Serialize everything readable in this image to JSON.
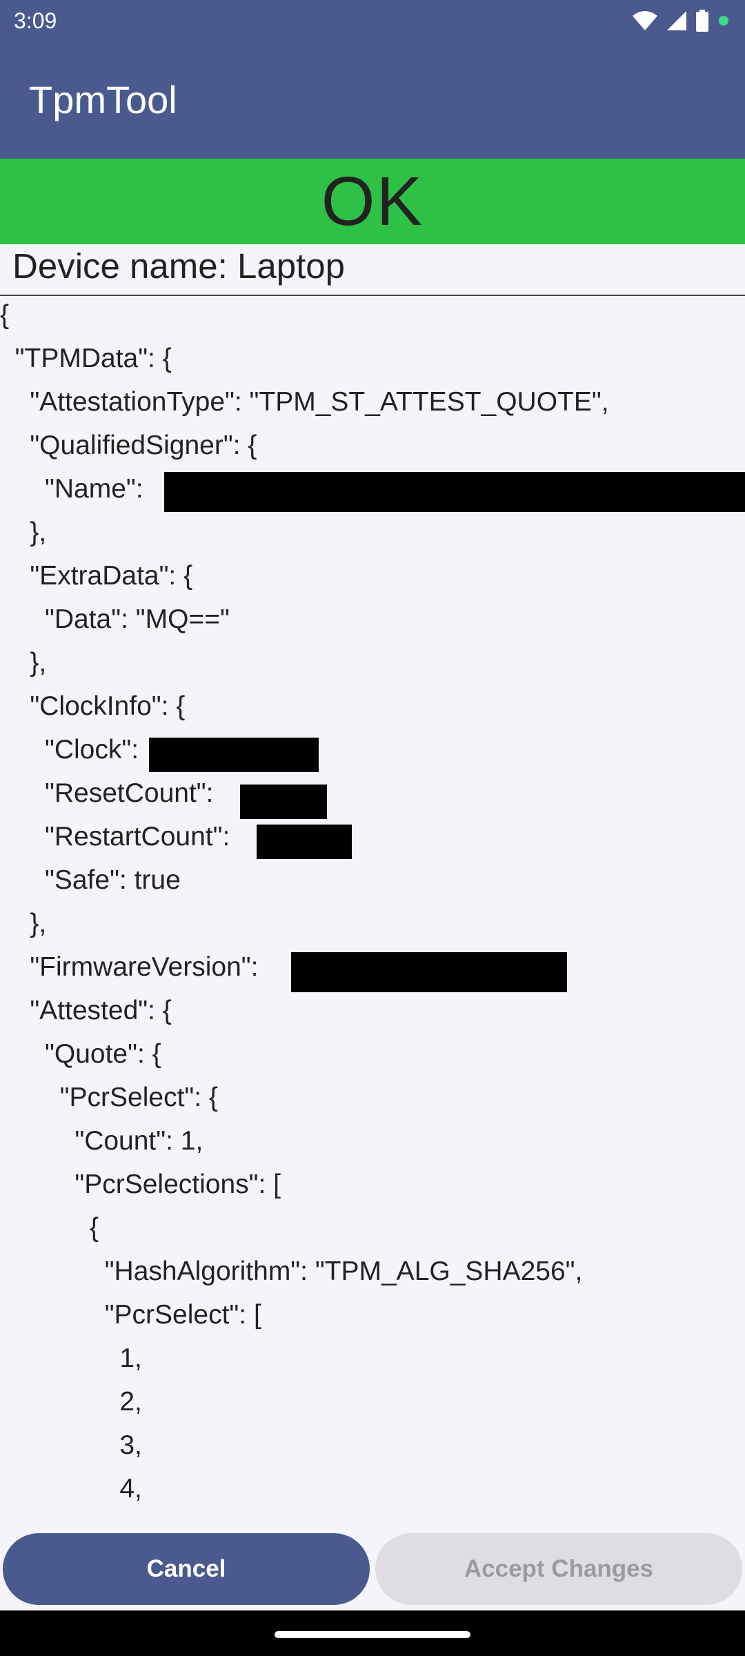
{
  "status_bar": {
    "time": "3:09",
    "icons": [
      "wifi-icon",
      "signal-icon",
      "battery-icon",
      "dot-indicator-icon"
    ]
  },
  "app_bar": {
    "title": "TpmTool"
  },
  "banner": {
    "text": "OK",
    "color": "#2ec145"
  },
  "device": {
    "label": "Device name: Laptop"
  },
  "json_lines": [
    "{",
    "  \"TPMData\": {",
    "    \"AttestationType\": \"TPM_ST_ATTEST_QUOTE\",",
    "    \"QualifiedSigner\": {",
    "      \"Name\": ",
    "    },",
    "    \"ExtraData\": {",
    "      \"Data\": \"MQ==\"",
    "    },",
    "    \"ClockInfo\": {",
    "      \"Clock\":",
    "      \"ResetCount\": ",
    "      \"RestartCount\":",
    "      \"Safe\": true",
    "    },",
    "    \"FirmwareVersion\":",
    "    \"Attested\": {",
    "      \"Quote\": {",
    "        \"PcrSelect\": {",
    "          \"Count\": 1,",
    "          \"PcrSelections\": [",
    "            {",
    "              \"HashAlgorithm\": \"TPM_ALG_SHA256\",",
    "              \"PcrSelect\": [",
    "                1,",
    "                2,",
    "                3,",
    "                4,"
  ],
  "buttons": {
    "cancel": "Cancel",
    "accept": "Accept Changes"
  },
  "colors": {
    "primary": "#4a5a8f",
    "success": "#2ec145",
    "disabled_bg": "#dedde4",
    "disabled_text": "#9a9aa3"
  }
}
